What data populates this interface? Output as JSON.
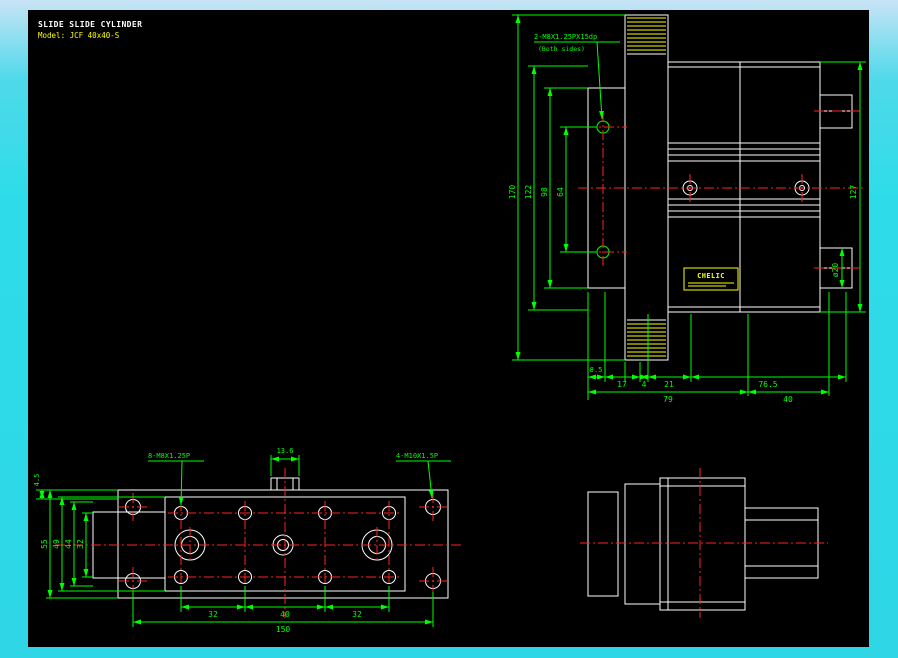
{
  "colors": {
    "background": "#2edce9",
    "background_top": "#c8e4f6",
    "canvas": "#000000",
    "geometry": "#ffffff",
    "dimension": "#00ff00",
    "centerline": "#ff2222",
    "accent": "#ffff00"
  },
  "title_block": {
    "title": "SLIDE SLIDE CYLINDER",
    "model": "Model: JCF 40x40-S"
  },
  "side_view": {
    "thread_callout": "2-M8X1.25PX15dp",
    "thread_note": "(Both sides)",
    "brand": "CHELIC",
    "dim_170": "170",
    "dim_122": "122",
    "dim_98": "98",
    "dim_64": "64",
    "dim_127": "127",
    "dim_rod": "ø20",
    "dim_8_5": "8.5",
    "dim_17": "17",
    "dim_4": "4",
    "dim_21": "21",
    "dim_76_5": "76.5",
    "dim_79": "79",
    "dim_40": "40"
  },
  "plan_view": {
    "callout_m8": "8-M8X1.25P",
    "callout_m10": "4-M10X1.5P",
    "dim_13_6": "13.6",
    "dim_4_5": "4.5",
    "dim_55": "55",
    "dim_49": "49",
    "dim_44": "44",
    "dim_32_left": "32",
    "dim_32a": "32",
    "dim_40": "40",
    "dim_32b": "32",
    "dim_150": "150"
  }
}
